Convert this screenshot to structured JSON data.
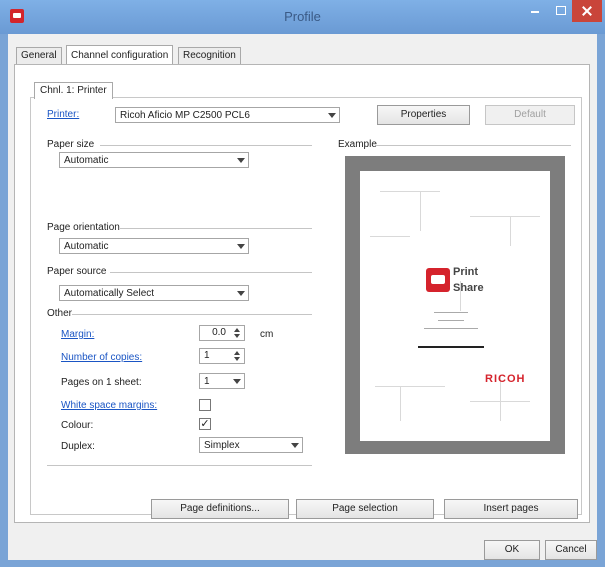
{
  "window": {
    "title": "Profile"
  },
  "tabs": [
    "General",
    "Channel configuration",
    "Recognition"
  ],
  "inner_tab": "Chnl. 1: Printer",
  "printer": {
    "label": "Printer:",
    "value": "Ricoh Aficio MP C2500 PCL6",
    "properties": "Properties",
    "default": "Default"
  },
  "paper_size": {
    "label": "Paper size",
    "value": "Automatic"
  },
  "page_orientation": {
    "label": "Page orientation",
    "value": "Automatic"
  },
  "paper_source": {
    "label": "Paper source",
    "value": "Automatically Select"
  },
  "other": {
    "label": "Other",
    "margin_label": "Margin:",
    "margin_value": "0.0",
    "margin_unit": "cm",
    "copies_label": "Number of copies:",
    "copies_value": "1",
    "pages_per_sheet_label": "Pages on 1 sheet:",
    "pages_per_sheet_value": "1",
    "white_space_label": "White space margins:",
    "white_space_checked": false,
    "colour_label": "Colour:",
    "colour_checked": true,
    "duplex_label": "Duplex:",
    "duplex_value": "Simplex"
  },
  "example": {
    "label": "Example",
    "logo_print": "Print",
    "logo_share": "Share",
    "brand": "RICOH"
  },
  "bottom_buttons": {
    "page_definitions": "Page definitions...",
    "page_selection": "Page selection",
    "insert_pages": "Insert pages"
  },
  "dialog_buttons": {
    "ok": "OK",
    "cancel": "Cancel"
  },
  "icons": {
    "app": "printshare-app-icon",
    "minimize": "minimize-icon",
    "maximize": "maximize-icon",
    "close": "close-icon"
  },
  "colors": {
    "accent": "#6a9ad4",
    "close": "#c9453a",
    "brand_red": "#d5232c",
    "link": "#1a55c4"
  }
}
